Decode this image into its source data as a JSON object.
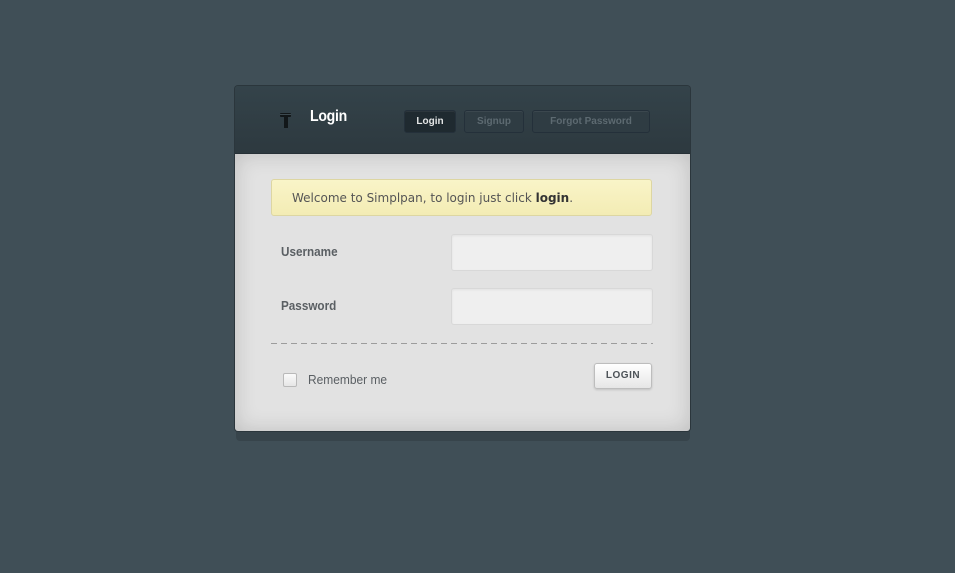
{
  "header": {
    "icon": "key-icon",
    "title": "Login",
    "tabs": [
      {
        "label": "Login",
        "active": true
      },
      {
        "label": "Signup",
        "active": false
      },
      {
        "label": "Forgot Password",
        "active": false
      }
    ]
  },
  "notice": {
    "text_before": "Welcome to Simplpan, to login just click ",
    "emphasis": "login",
    "text_after": "."
  },
  "form": {
    "username_label": "Username",
    "username_value": "",
    "password_label": "Password",
    "password_value": "",
    "remember_label": "Remember me",
    "remember_checked": false,
    "submit_label": "LOGIN"
  },
  "colors": {
    "background": "#404f57",
    "header": "#2f3c43",
    "body": "#e2e2e2",
    "notice": "#f6f0bf"
  }
}
